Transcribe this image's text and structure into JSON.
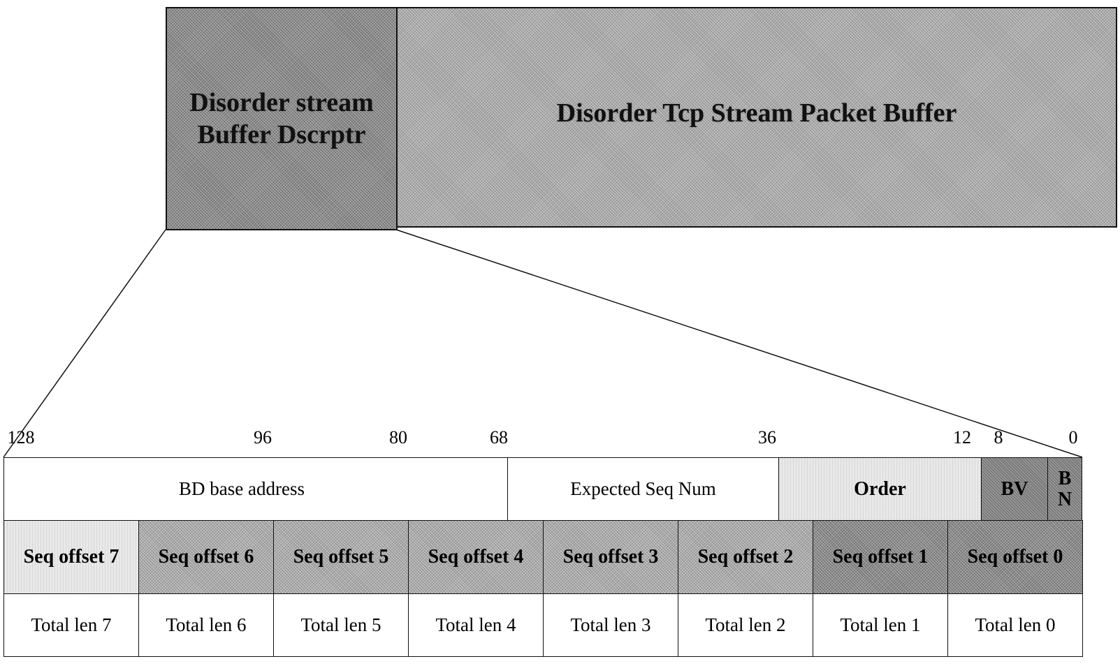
{
  "top": {
    "descriptor_label": "Disorder stream Buffer Dscrptr",
    "descriptor_line1": "Disorder stream",
    "descriptor_line2": "Buffer Dscrptr",
    "packet_buffer_label": "Disorder Tcp Stream Packet Buffer"
  },
  "bit_positions": [
    "128",
    "96",
    "80",
    "68",
    "36",
    "12",
    "8",
    "0"
  ],
  "row1": {
    "bd_base_address": "BD base address",
    "expected_seq_num": "Expected Seq Num",
    "order": "Order",
    "bv": "BV",
    "bn_line1": "B",
    "bn_line2": "N"
  },
  "seq_offsets": [
    "Seq offset 7",
    "Seq offset 6",
    "Seq offset 5",
    "Seq offset 4",
    "Seq offset 3",
    "Seq offset 2",
    "Seq offset 1",
    "Seq offset 0"
  ],
  "total_lens": [
    "Total len 7",
    "Total len 6",
    "Total len 5",
    "Total len 4",
    "Total len 3",
    "Total len 2",
    "Total len 1",
    "Total len 0"
  ]
}
